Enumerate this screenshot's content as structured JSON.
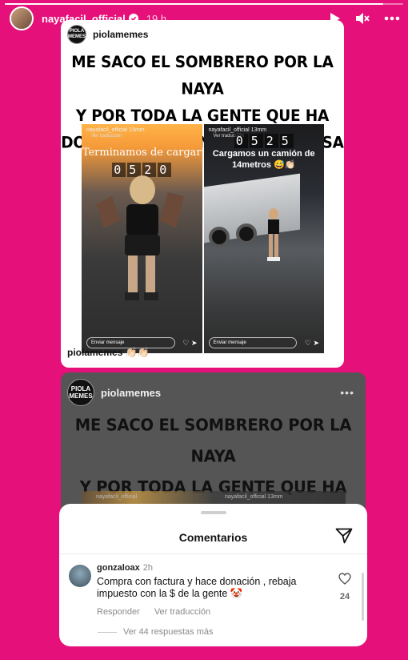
{
  "story": {
    "progress": 0.95,
    "username": "nayafacil_official",
    "time": "19 h",
    "icons": {
      "play": "play-icon",
      "mute": "speaker-muted-icon",
      "more": "more-horizontal-icon",
      "verified": "verified-badge-icon"
    },
    "colors": {
      "background": "#e6107a",
      "verified": "#3897f0"
    }
  },
  "post": {
    "username": "piolamemes",
    "logo_text": [
      "PIOLA",
      "MEMES"
    ],
    "headline": [
      "ME SACO EL SOMBRERO POR LA NAYA",
      "Y POR TODA LA GENTE QUE HA",
      "DONADO PARA UNA BUENA CAUSA"
    ],
    "caption_user": "piolamemes",
    "caption_text": "👏🏻👏🏻",
    "photos": [
      {
        "user": "nayafacil_official  15mm",
        "translate": "Ver traducción",
        "caption": "Terminamos  de cargar",
        "counter": [
          "0",
          "5",
          "2",
          "0"
        ],
        "message_placeholder": "Enviar mensaje"
      },
      {
        "user": "nayafacil_official  13mm",
        "translate": "Ver traducción",
        "caption": "Cargamos un camión de 14metros 😅👏🏻",
        "counter": [
          "0",
          "5",
          "2",
          "5"
        ],
        "message_placeholder": "Enviar mensaje"
      }
    ],
    "strip_labels": [
      "nayafacil_official",
      "nayafacil_official 13mm"
    ]
  },
  "comments": {
    "title": "Comentarios",
    "items": [
      {
        "user": "gonzaloax",
        "time": "2h",
        "text": "Compra con factura y hace donación , rebaja impuesto con la $ de la gente 🤡",
        "likes": "24",
        "reply_label": "Responder",
        "translate_label": "Ver traducción"
      }
    ],
    "more_replies": "Ver 44 respuestas más"
  }
}
